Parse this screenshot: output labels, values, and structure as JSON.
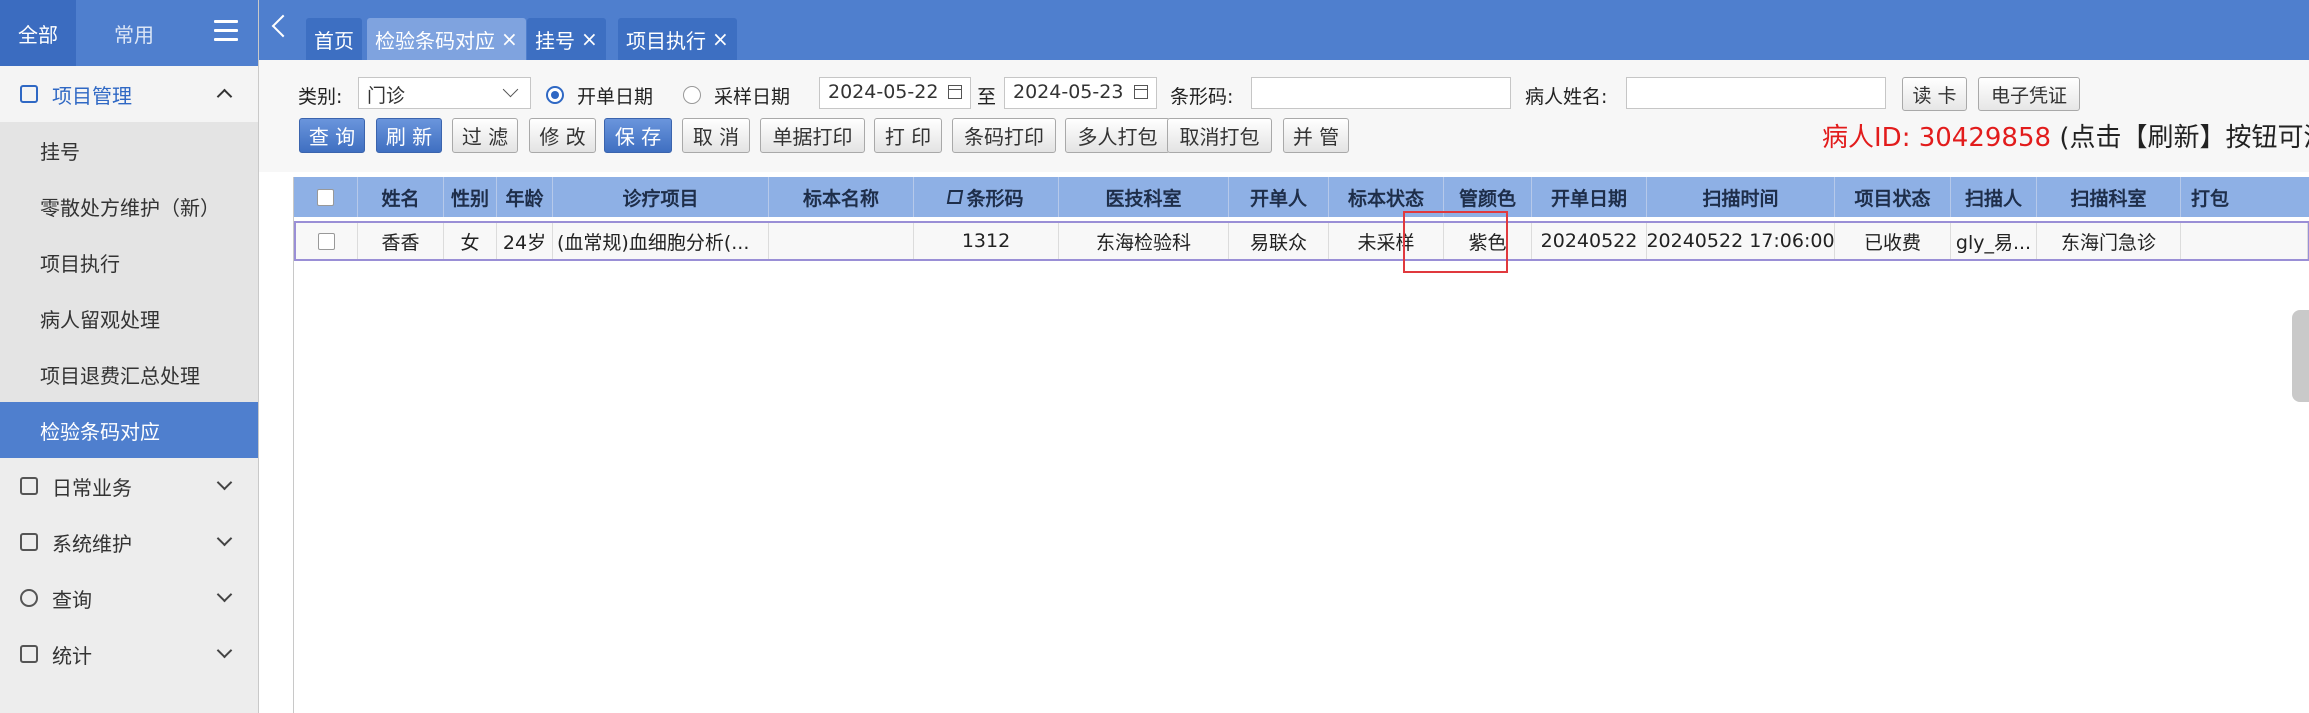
{
  "sidebar": {
    "tabs": [
      "全部",
      "常用"
    ],
    "groups": [
      {
        "label": "项目管理",
        "icon": "folder-icon",
        "open": true
      },
      {
        "label": "日常业务",
        "icon": "mail-icon"
      },
      {
        "label": "系统维护",
        "icon": "monitor-icon"
      },
      {
        "label": "查询",
        "icon": "search-icon"
      },
      {
        "label": "统计",
        "icon": "chart-icon"
      }
    ],
    "items": [
      "挂号",
      "零散处方维护（新）",
      "项目执行",
      "病人留观处理",
      "项目退费汇总处理",
      "检验条码对应"
    ]
  },
  "tabs": {
    "home": "首页",
    "open": [
      {
        "label": "检验条码对应",
        "close": "×"
      },
      {
        "label": "挂号",
        "close": "×"
      },
      {
        "label": "项目执行",
        "close": "×"
      }
    ]
  },
  "filters": {
    "category_label": "类别:",
    "category_value": "门诊",
    "radio_order_date": "开单日期",
    "radio_sample_date": "采样日期",
    "date_from": "2024-05-22",
    "date_to_label": "至",
    "date_to": "2024-05-23",
    "barcode_label": "条形码:",
    "barcode_value": "",
    "patient_name_label": "病人姓名:",
    "patient_name_value": "",
    "read_card": "读 卡",
    "e_voucher": "电子凭证"
  },
  "buttons": [
    "查 询",
    "刷 新",
    "过 滤",
    "修 改",
    "保 存",
    "取 消",
    "单据打印",
    "打 印",
    "条码打印",
    "多人打包",
    "取消打包",
    "并 管"
  ],
  "patient_msg": {
    "red": "病人ID: 30429858 ",
    "black": "(点击【刷新】按钮可清空"
  },
  "table": {
    "columns": [
      "",
      "姓名",
      "性别",
      "年龄",
      "诊疗项目",
      "标本名称",
      "条形码",
      "医技科室",
      "开单人",
      "标本状态",
      "管颜色",
      "开单日期",
      "扫描时间",
      "项目状态",
      "扫描人",
      "扫描科室",
      "打包"
    ],
    "rows": [
      [
        "",
        "香香",
        "女",
        "24岁",
        "(血常规)血细胞分析(...",
        "",
        "1312",
        "东海检验科",
        "易联众",
        "未采样",
        "紫色",
        "20240522",
        "20240522 17:06:00",
        "已收费",
        "gly_易...",
        "东海门急诊",
        ""
      ]
    ]
  },
  "colors": {
    "header_blue": "#4f7fce",
    "grid_header": "#8eb0e5",
    "highlight_red": "#e0393e",
    "msg_red": "#e21c1c"
  }
}
